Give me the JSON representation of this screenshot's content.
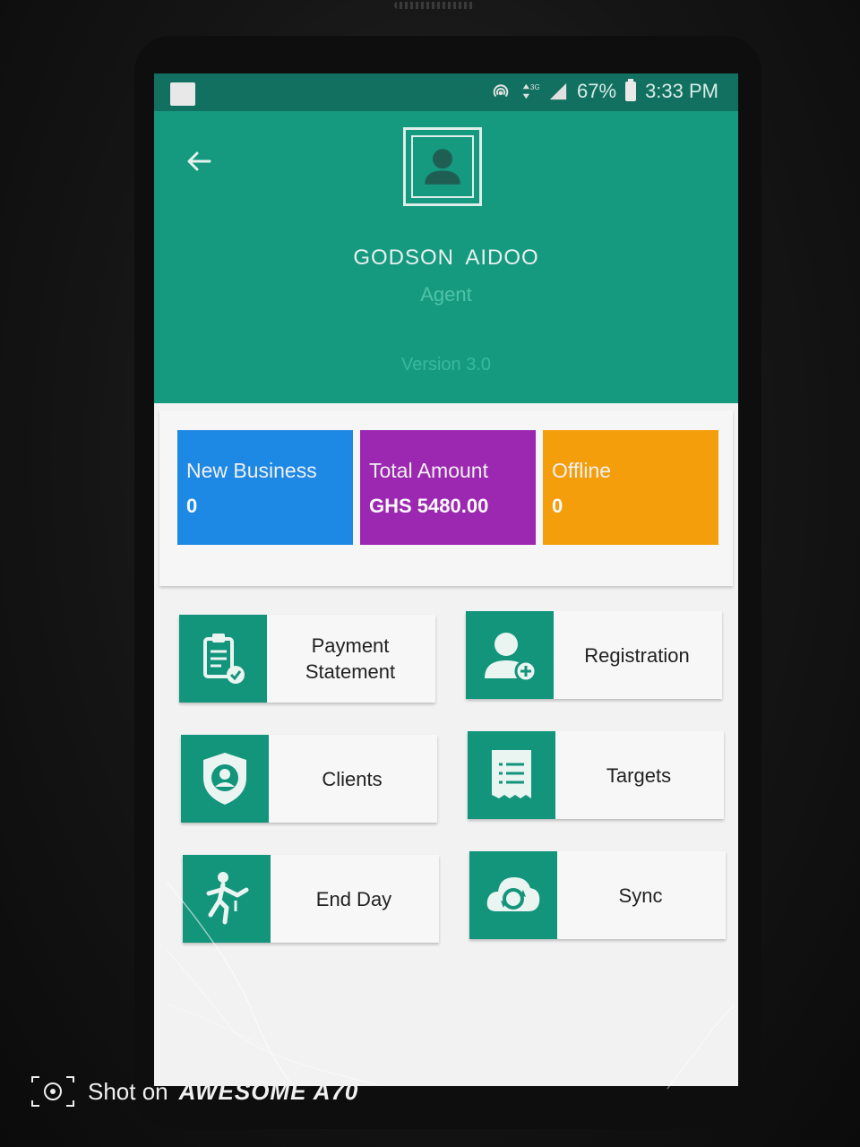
{
  "status_bar": {
    "battery": "67%",
    "time": "3:33 PM",
    "network": "3G",
    "icons": [
      "hotspot-icon",
      "data-arrows-icon",
      "signal-icon",
      "battery-icon"
    ]
  },
  "header": {
    "user_name": "GODSON  AIDOO",
    "role": "Agent",
    "version": "Version 3.0",
    "color": "#159a80"
  },
  "stats": [
    {
      "label": "New Business",
      "value": "0",
      "color": "#1e88e5"
    },
    {
      "label": "Total Amount",
      "value": "GHS 5480.00",
      "color": "#9c27b0"
    },
    {
      "label": "Offline",
      "value": "0",
      "color": "#f59e0b"
    }
  ],
  "menu": [
    {
      "label": "Payment\nStatement",
      "icon": "clipboard-check-icon"
    },
    {
      "label": "Registration",
      "icon": "add-user-icon"
    },
    {
      "label": "Clients",
      "icon": "shield-user-icon"
    },
    {
      "label": "Targets",
      "icon": "receipt-list-icon"
    },
    {
      "label": "End Day",
      "icon": "running-person-icon"
    },
    {
      "label": "Sync",
      "icon": "cloud-sync-icon"
    }
  ],
  "watermark": {
    "prefix": "Shot on",
    "brand": "AWESOME  A70"
  }
}
